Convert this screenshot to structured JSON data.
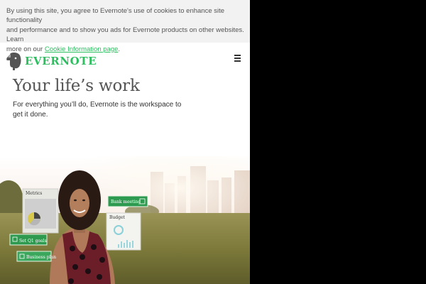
{
  "cookie_banner": {
    "line1": "By using this site, you agree to Evernote's use of cookies to enhance site functionality",
    "line2": "and performance and to show you ads for Evernote products on other websites. Learn",
    "line3_prefix": "more on our ",
    "link_text": "Cookie Information page",
    "line3_suffix": "."
  },
  "header": {
    "logo_text": "EVERNOTE",
    "menu_icon": "hamburger-menu-icon"
  },
  "hero": {
    "title": "Your life’s work",
    "subtitle_line1": "For everything you’ll do, Evernote is the workspace to",
    "subtitle_line2": "get it done."
  },
  "hero_cards": {
    "metrics": "Metrics",
    "bank_meeting": "Bank meeting",
    "budget": "Budget",
    "set_q1_goals": "Set Q1 goals",
    "business_plan": "Business plan"
  },
  "colors": {
    "brand_green": "#2dbe60",
    "banner_bg": "#f2f2f2",
    "page_bg": "#ffffff",
    "outside_bg": "#000000"
  }
}
